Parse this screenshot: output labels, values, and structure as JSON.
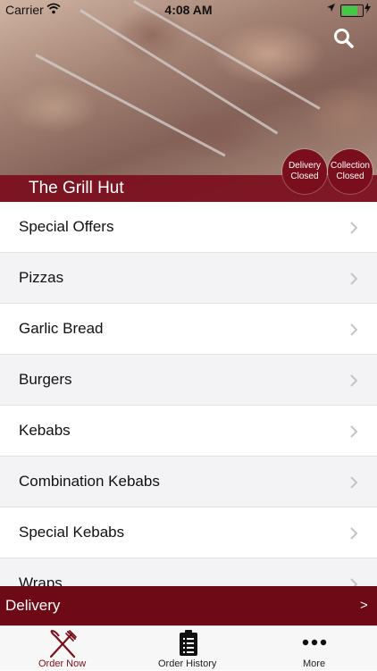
{
  "status_bar": {
    "carrier": "Carrier",
    "time": "4:08 AM",
    "battery_level": 0.75,
    "icons": [
      "wifi-icon",
      "location-arrow-icon",
      "battery-icon",
      "charging-bolt-icon"
    ]
  },
  "header": {
    "restaurant_name": "The Grill Hut",
    "search_icon": "search-icon",
    "delivery_badge": {
      "line1": "Delivery",
      "line2": "Closed"
    },
    "collection_badge": {
      "line1": "Collection",
      "line2": "Closed"
    }
  },
  "menu": {
    "items": [
      {
        "label": "Special Offers"
      },
      {
        "label": "Pizzas"
      },
      {
        "label": "Garlic Bread"
      },
      {
        "label": "Burgers"
      },
      {
        "label": "Kebabs"
      },
      {
        "label": "Combination Kebabs"
      },
      {
        "label": "Special Kebabs"
      },
      {
        "label": "Wraps"
      }
    ],
    "chevron_icon": "chevron-right-icon"
  },
  "delivery_bar": {
    "label": "Delivery",
    "arrow": ">"
  },
  "tab_bar": {
    "tabs": [
      {
        "label": "Order Now",
        "icon": "fork-knife-icon",
        "active": true
      },
      {
        "label": "Order History",
        "icon": "clipboard-list-icon",
        "active": false
      },
      {
        "label": "More",
        "icon": "more-dots-icon",
        "active": false
      }
    ]
  },
  "colors": {
    "brand": "#7b0e1c",
    "delivery_bar": "#6d0a16",
    "row_alt": "#f3f3f5",
    "tab_bar_bg": "#f7f7f7"
  }
}
